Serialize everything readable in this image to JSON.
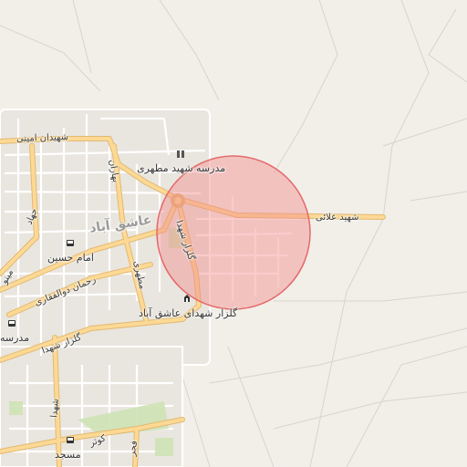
{
  "map": {
    "place_label": "عاشق آباد",
    "roads": {
      "north_street": "شهیدان امینی",
      "east_street": "شهید علائی",
      "gulzar_shohada_main": "گلزار شهدا",
      "gulzar_shohada_west": "گلزار شهدا",
      "rahman_zolfaghari": "رحمان ذوالفقاری",
      "motahhari": "مطهری",
      "baharan": "بهاران",
      "jihad": "جهاد",
      "mino": "مینو",
      "kowsar": "کوثر",
      "fajr": "فجر",
      "shohada_south": "شهدا"
    },
    "pois": {
      "school_motahhari": "مدرسه شهید مطهری",
      "school_west": "مدرسه",
      "imam_hossein": "امام حسین",
      "masjid": "مسجد",
      "golzar_shohada_ashegh_abad": "گلزار شهدای عاشق آباد"
    },
    "icons": {
      "school": "school-icon",
      "bus": "bus-stop-icon",
      "cemetery": "monument-icon"
    },
    "colors": {
      "background": "#f2efe9",
      "major_road": "#fcd994",
      "major_road_casing": "#e3b872",
      "minor_road": "#ffffff",
      "highlight_fill": "#f28b8b",
      "highlight_stroke": "#e46a6a",
      "park": "#cfe3b5"
    }
  }
}
